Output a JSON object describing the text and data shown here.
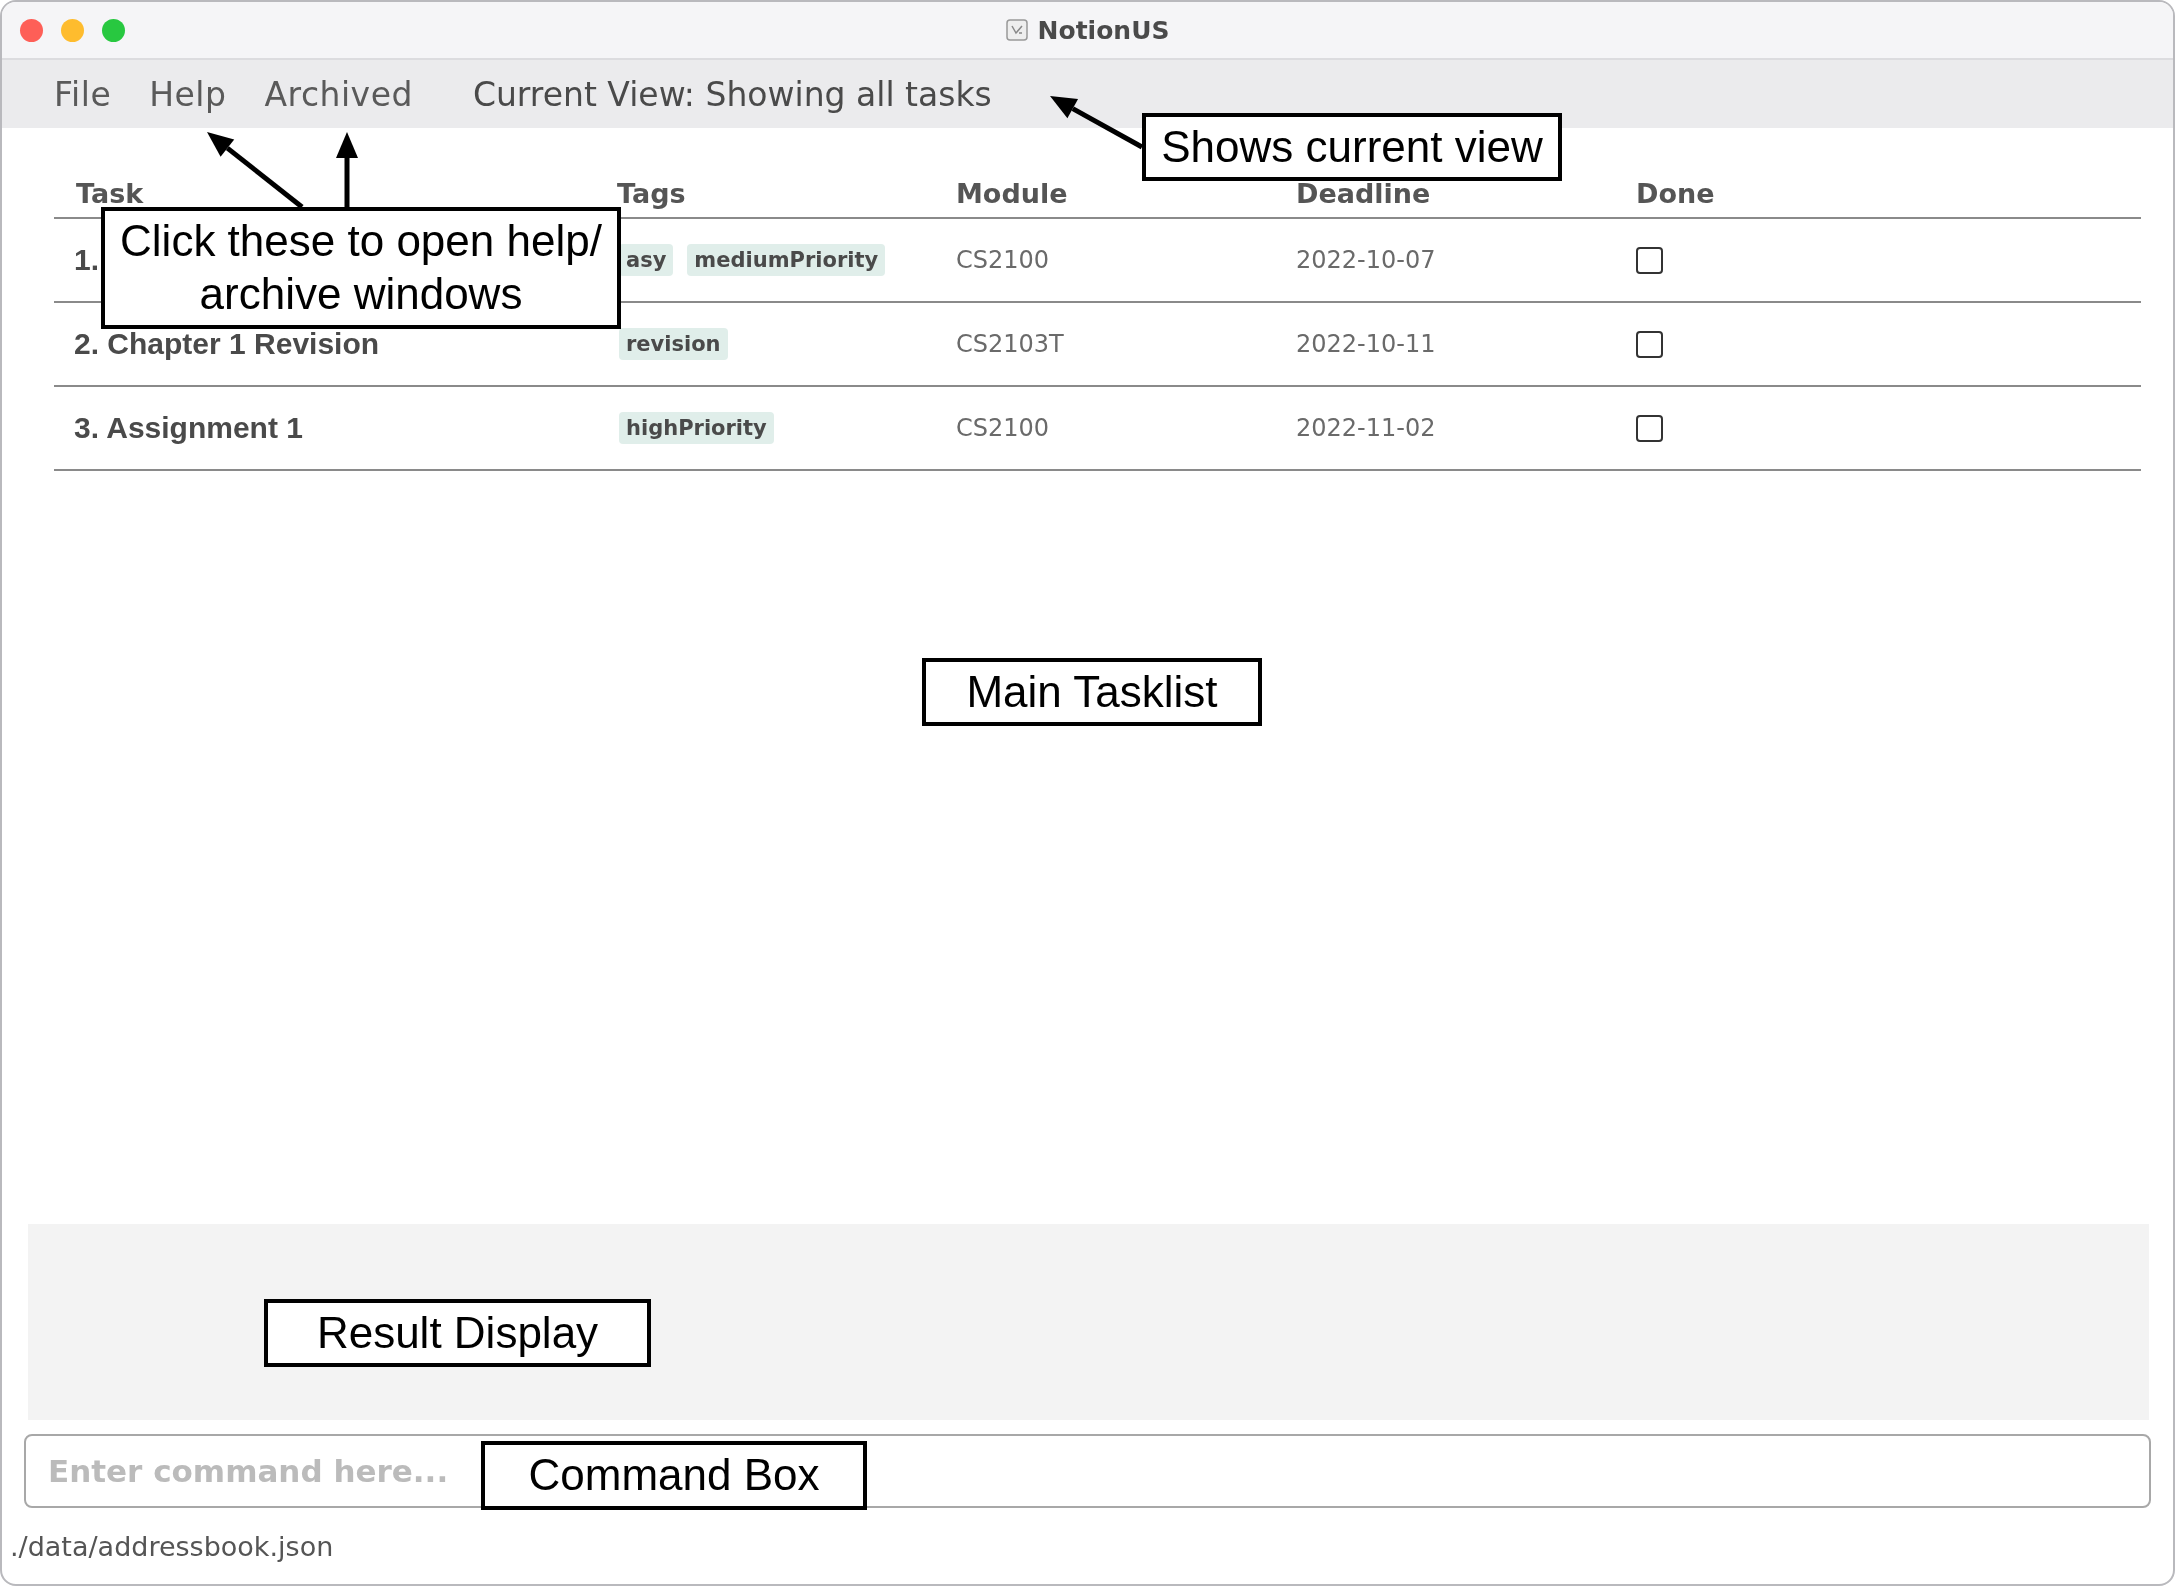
{
  "window": {
    "title": "NotionUS"
  },
  "menu": [
    {
      "label": "File"
    },
    {
      "label": "Help"
    },
    {
      "label": "Archived"
    }
  ],
  "current_view": "Current View: Showing all tasks",
  "table": {
    "columns": [
      "Task",
      "Tags",
      "Module",
      "Deadline",
      "Done"
    ],
    "rows": [
      {
        "task": "1.",
        "tags": [
          "asy",
          "mediumPriority"
        ],
        "module": "CS2100",
        "deadline": "2022-10-07",
        "checked": false
      },
      {
        "task": "2. Chapter 1 Revision",
        "tags": [
          "revision"
        ],
        "module": "CS2103T",
        "deadline": "2022-10-11",
        "checked": false
      },
      {
        "task": "3. Assignment 1",
        "tags": [
          "highPriority"
        ],
        "module": "CS2100",
        "deadline": "2022-11-02",
        "checked": false
      }
    ]
  },
  "command_box": {
    "placeholder": "Enter command here..."
  },
  "status_bar": "./data/addressbook.json",
  "annotations": [
    {
      "text": "Shows current view"
    },
    {
      "text": "Click these to open help/ archive windows"
    },
    {
      "text": "Main Tasklist"
    },
    {
      "text": "Result Display"
    },
    {
      "text": "Command Box"
    }
  ]
}
